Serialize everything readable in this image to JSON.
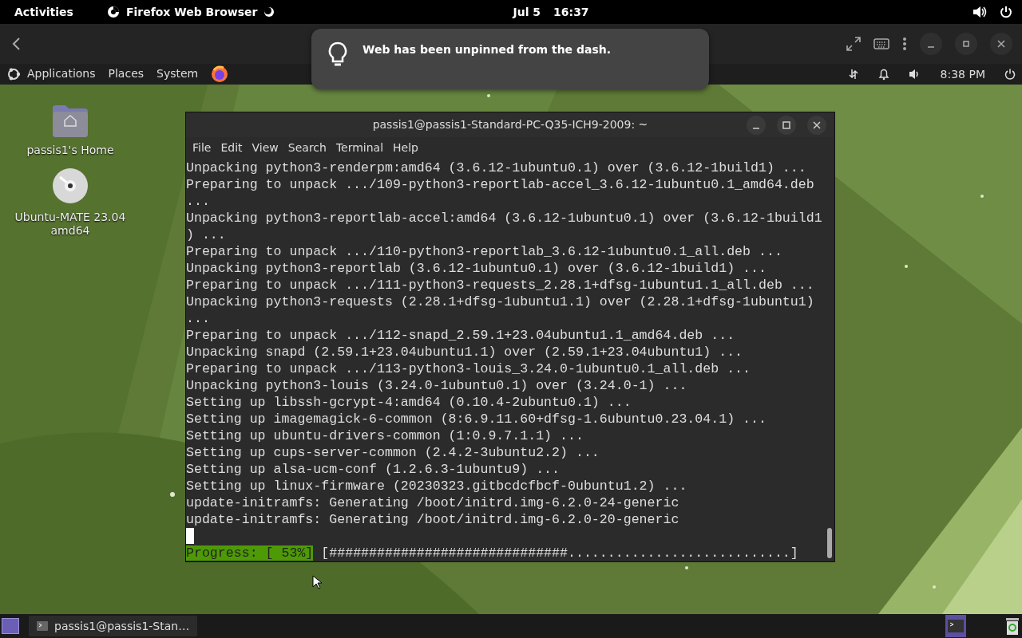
{
  "top_bar": {
    "activities": "Activities",
    "app": {
      "name": "Firefox Web Browser",
      "loading": true
    },
    "date": "Jul 5",
    "time": "16:37"
  },
  "notification": {
    "message": "Web has been unpinned from the dash."
  },
  "panel": {
    "menus": [
      "Applications",
      "Places",
      "System"
    ],
    "clock": "8:38 PM"
  },
  "desktop_icons": [
    {
      "kind": "folder",
      "label": "passis1's Home"
    },
    {
      "kind": "disc",
      "label": "Ubuntu-MATE 23.04 amd64"
    }
  ],
  "terminal": {
    "title": "passis1@passis1-Standard-PC-Q35-ICH9-2009: ~",
    "menu": [
      "File",
      "Edit",
      "View",
      "Search",
      "Terminal",
      "Help"
    ],
    "lines": [
      "Unpacking python3-renderpm:amd64 (3.6.12-1ubuntu0.1) over (3.6.12-1build1) ...",
      "Preparing to unpack .../109-python3-reportlab-accel_3.6.12-1ubuntu0.1_amd64.deb",
      "...",
      "Unpacking python3-reportlab-accel:amd64 (3.6.12-1ubuntu0.1) over (3.6.12-1build1",
      ") ...",
      "Preparing to unpack .../110-python3-reportlab_3.6.12-1ubuntu0.1_all.deb ...",
      "Unpacking python3-reportlab (3.6.12-1ubuntu0.1) over (3.6.12-1build1) ...",
      "Preparing to unpack .../111-python3-requests_2.28.1+dfsg-1ubuntu1.1_all.deb ...",
      "Unpacking python3-requests (2.28.1+dfsg-1ubuntu1.1) over (2.28.1+dfsg-1ubuntu1)",
      "...",
      "Preparing to unpack .../112-snapd_2.59.1+23.04ubuntu1.1_amd64.deb ...",
      "Unpacking snapd (2.59.1+23.04ubuntu1.1) over (2.59.1+23.04ubuntu1) ...",
      "Preparing to unpack .../113-python3-louis_3.24.0-1ubuntu0.1_all.deb ...",
      "Unpacking python3-louis (3.24.0-1ubuntu0.1) over (3.24.0-1) ...",
      "Setting up libssh-gcrypt-4:amd64 (0.10.4-2ubuntu0.1) ...",
      "Setting up imagemagick-6-common (8:6.9.11.60+dfsg-1.6ubuntu0.23.04.1) ...",
      "Setting up ubuntu-drivers-common (1:0.9.7.1.1) ...",
      "Setting up cups-server-common (2.4.2-3ubuntu2.2) ...",
      "Setting up alsa-ucm-conf (1.2.6.3-1ubuntu9) ...",
      "Setting up linux-firmware (20230323.gitbcdcfbcf-0ubuntu1.2) ...",
      "update-initramfs: Generating /boot/initrd.img-6.2.0-24-generic",
      "update-initramfs: Generating /boot/initrd.img-6.2.0-20-generic"
    ],
    "progress": {
      "label": "Progress: [ 53%]",
      "bar": "[##############################............................]"
    }
  },
  "taskbar": {
    "items": [
      {
        "label": "passis1@passis1-Stan…",
        "selected": false
      }
    ]
  }
}
